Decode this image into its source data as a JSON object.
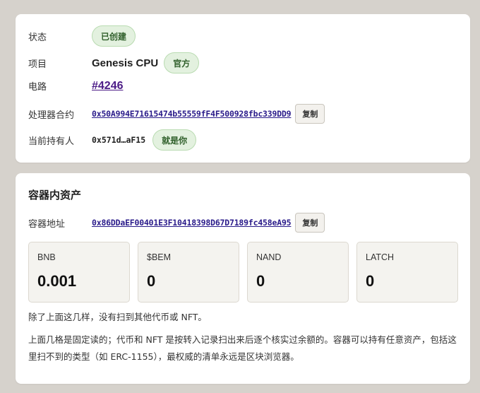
{
  "details": {
    "status_label": "状态",
    "status_value": "已创建",
    "project_label": "项目",
    "project_name": "Genesis CPU",
    "project_badge": "官方",
    "circuit_label": "电路",
    "circuit_value": "#4246",
    "contract_label": "处理器合约",
    "contract_address": "0x50A994E71615474b55559fF4F500928fbc339DD9",
    "contract_copy": "复制",
    "owner_label": "当前持有人",
    "owner_address": "0x571d…aF15",
    "owner_badge": "就是你"
  },
  "assets_section": {
    "title": "容器内资产",
    "container_label": "容器地址",
    "container_address": "0x86DDaEF00401E3F10418398D67D7189fc458eA95",
    "container_copy": "复制",
    "assets": [
      {
        "name": "BNB",
        "value": "0.001"
      },
      {
        "name": "$BEM",
        "value": "0"
      },
      {
        "name": "NAND",
        "value": "0"
      },
      {
        "name": "LATCH",
        "value": "0"
      }
    ],
    "note_1": "除了上面这几样，没有扫到其他代币或 NFT。",
    "note_2": "上面几格是固定读的；代币和 NFT 是按转入记录扫出来后逐个核实过余额的。容器可以持有任意资产，包括这里扫不到的类型（如 ERC-1155），最权威的清单永远是区块浏览器。"
  },
  "colors": {
    "background": "#d6d2cc",
    "badge_bg": "#e3f1df",
    "badge_text": "#2f5f2a",
    "link": "#2a1b8a",
    "circuit_link": "#4b1b86"
  }
}
